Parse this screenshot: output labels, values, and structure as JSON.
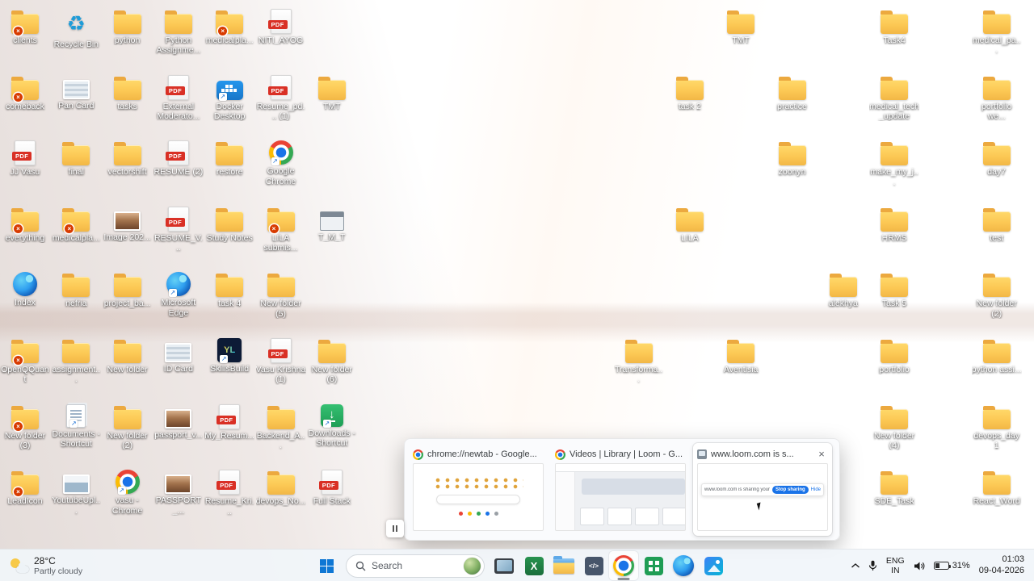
{
  "wallpaper": {
    "sky": "#c6cad1",
    "dune": "#d5b3a0",
    "sun": "#ffffff"
  },
  "desktop": {
    "glyphs": {
      "pdf": "PDF",
      "skills": "YL",
      "download": "↓",
      "recycle": "♻"
    },
    "shortcut_glyph": "↗",
    "badge_glyph": "×",
    "icons": [
      {
        "label": "clients",
        "type": "folder",
        "col": 0,
        "row": 0,
        "badge": true
      },
      {
        "label": "comeback",
        "type": "folder",
        "col": 0,
        "row": 1,
        "badge": true
      },
      {
        "label": "JJ Vasu",
        "type": "pdf",
        "col": 0,
        "row": 2
      },
      {
        "label": "everything",
        "type": "folder",
        "col": 0,
        "row": 3,
        "badge": true
      },
      {
        "label": "Index",
        "type": "edge",
        "col": 0,
        "row": 4
      },
      {
        "label": "OpenQQuant",
        "type": "folder",
        "col": 0,
        "row": 5,
        "badge": true
      },
      {
        "label": "New folder (3)",
        "type": "folder",
        "col": 0,
        "row": 6,
        "badge": true
      },
      {
        "label": "LeadIcon",
        "type": "folder",
        "col": 0,
        "row": 7,
        "badge": true
      },
      {
        "label": "Recycle Bin",
        "type": "recycle",
        "col": 1,
        "row": 0
      },
      {
        "label": "Pan Card",
        "type": "photo",
        "variant": "card",
        "col": 1,
        "row": 1
      },
      {
        "label": "final",
        "type": "folder",
        "col": 1,
        "row": 2
      },
      {
        "label": "medicalpla...",
        "type": "folder",
        "col": 1,
        "row": 3,
        "badge": true
      },
      {
        "label": "nefria",
        "type": "folder",
        "col": 1,
        "row": 4
      },
      {
        "label": "assignment...",
        "type": "folder",
        "col": 1,
        "row": 5
      },
      {
        "label": "Documents - Shortcut",
        "type": "docs",
        "col": 1,
        "row": 6,
        "shortcut": true
      },
      {
        "label": "YoutubeUpl...",
        "type": "photo",
        "variant": "video",
        "col": 1,
        "row": 7
      },
      {
        "label": "python",
        "type": "folder",
        "col": 2,
        "row": 0
      },
      {
        "label": "tasks",
        "type": "folder",
        "col": 2,
        "row": 1
      },
      {
        "label": "vectorshift",
        "type": "folder",
        "col": 2,
        "row": 2
      },
      {
        "label": "Image 202...",
        "type": "photo",
        "variant": "person",
        "col": 2,
        "row": 3
      },
      {
        "label": "project_ba...",
        "type": "folder",
        "col": 2,
        "row": 4
      },
      {
        "label": "New folder",
        "type": "folder",
        "col": 2,
        "row": 5
      },
      {
        "label": "New folder (2)",
        "type": "folder",
        "col": 2,
        "row": 6
      },
      {
        "label": "vasu - Chrome",
        "type": "chrome",
        "col": 2,
        "row": 7,
        "shortcut": true
      },
      {
        "label": "Python Assignme...",
        "type": "folder",
        "col": 3,
        "row": 0
      },
      {
        "label": "External Moderato...",
        "type": "pdf",
        "col": 3,
        "row": 1
      },
      {
        "label": "RESUME (2)",
        "type": "pdf",
        "col": 3,
        "row": 2
      },
      {
        "label": "RESUME_V...",
        "type": "pdf",
        "col": 3,
        "row": 3
      },
      {
        "label": "Microsoft Edge",
        "type": "edge",
        "col": 3,
        "row": 4,
        "shortcut": true
      },
      {
        "label": "ID Card",
        "type": "photo",
        "variant": "card",
        "col": 3,
        "row": 5
      },
      {
        "label": "passport_v...",
        "type": "photo",
        "variant": "person",
        "col": 3,
        "row": 6
      },
      {
        "label": "PASSPORT_...",
        "type": "photo",
        "variant": "person",
        "col": 3,
        "row": 7
      },
      {
        "label": "medicalpla...",
        "type": "folder",
        "col": 4,
        "row": 0,
        "badge": true
      },
      {
        "label": "Docker Desktop",
        "type": "docker",
        "col": 4,
        "row": 1,
        "shortcut": true
      },
      {
        "label": "restore",
        "type": "folder",
        "col": 4,
        "row": 2
      },
      {
        "label": "Study Notes",
        "type": "folder",
        "col": 4,
        "row": 3
      },
      {
        "label": "task 4",
        "type": "folder",
        "col": 4,
        "row": 4
      },
      {
        "label": "SkillsBuild",
        "type": "skills",
        "col": 4,
        "row": 5,
        "shortcut": true
      },
      {
        "label": "My_Resum...",
        "type": "pdf",
        "col": 4,
        "row": 6
      },
      {
        "label": "Resume_Kri...",
        "type": "pdf",
        "col": 4,
        "row": 7
      },
      {
        "label": "NITI_AYOG",
        "type": "pdf",
        "col": 5,
        "row": 0
      },
      {
        "label": "Resume_pd... (1)",
        "type": "pdf",
        "col": 5,
        "row": 1
      },
      {
        "label": "Google Chrome",
        "type": "chrome",
        "col": 5,
        "row": 2,
        "shortcut": true
      },
      {
        "label": "LILA submis...",
        "type": "folder",
        "col": 5,
        "row": 3,
        "badge": true
      },
      {
        "label": "New folder (5)",
        "type": "folder",
        "col": 5,
        "row": 4
      },
      {
        "label": "Vasu Krishna (1)",
        "type": "pdf",
        "col": 5,
        "row": 5
      },
      {
        "label": "Backend_A...",
        "type": "folder",
        "col": 5,
        "row": 6
      },
      {
        "label": "devops_No...",
        "type": "folder",
        "col": 5,
        "row": 7
      },
      {
        "label": "TMT",
        "type": "folder",
        "col": 6,
        "row": 1
      },
      {
        "label": "T_M_T",
        "type": "app",
        "col": 6,
        "row": 3
      },
      {
        "label": "New folder (6)",
        "type": "folder",
        "col": 6,
        "row": 5
      },
      {
        "label": "Downloads - Shortcut",
        "type": "download",
        "col": 6,
        "row": 6,
        "shortcut": true
      },
      {
        "label": "Full Stack",
        "type": "pdf",
        "col": 6,
        "row": 7
      },
      {
        "label": "Transforma...",
        "type": "folder",
        "col": 12,
        "row": 5
      },
      {
        "label": "task 2",
        "type": "folder",
        "col": 13,
        "row": 1
      },
      {
        "label": "LILA",
        "type": "folder",
        "col": 13,
        "row": 3
      },
      {
        "label": "TMT",
        "type": "folder",
        "col": 14,
        "row": 0
      },
      {
        "label": "Aventisia",
        "type": "folder",
        "col": 14,
        "row": 5
      },
      {
        "label": "practice",
        "type": "folder",
        "col": 15,
        "row": 1
      },
      {
        "label": "zoonyn",
        "type": "folder",
        "col": 15,
        "row": 2
      },
      {
        "label": "alekhya",
        "type": "folder",
        "col": 16,
        "row": 4
      },
      {
        "label": "Task4",
        "type": "folder",
        "col": 17,
        "row": 0
      },
      {
        "label": "medical_tech_update",
        "type": "folder",
        "col": 17,
        "row": 1
      },
      {
        "label": "make_my_j...",
        "type": "folder",
        "col": 17,
        "row": 2
      },
      {
        "label": "HRMS",
        "type": "folder",
        "col": 17,
        "row": 3
      },
      {
        "label": "Task 5",
        "type": "folder",
        "col": 17,
        "row": 4
      },
      {
        "label": "portfolio",
        "type": "folder",
        "col": 17,
        "row": 5
      },
      {
        "label": "New folder (4)",
        "type": "folder",
        "col": 17,
        "row": 6
      },
      {
        "label": "SDE_Task",
        "type": "folder",
        "col": 17,
        "row": 7
      },
      {
        "label": "medical_pa...",
        "type": "folder",
        "col": 19,
        "row": 0
      },
      {
        "label": "portfolio we...",
        "type": "folder",
        "col": 19,
        "row": 1
      },
      {
        "label": "day7",
        "type": "folder",
        "col": 19,
        "row": 2
      },
      {
        "label": "test",
        "type": "folder",
        "col": 19,
        "row": 3
      },
      {
        "label": "New folder (2)",
        "type": "folder",
        "col": 19,
        "row": 4
      },
      {
        "label": "python assi...",
        "type": "folder",
        "col": 19,
        "row": 5
      },
      {
        "label": "devops_day1",
        "type": "folder",
        "col": 19,
        "row": 6
      },
      {
        "label": "React_Word",
        "type": "folder",
        "col": 19,
        "row": 7
      }
    ]
  },
  "popup": {
    "close_glyph": "×",
    "cards": [
      {
        "title": "chrome://newtab - Google..."
      },
      {
        "title": "Videos | Library | Loom - G..."
      },
      {
        "title": "www.loom.com is s...",
        "sharing_text": "www.loom.com is sharing your screen",
        "stop_button": "Stop sharing",
        "hide_link": "Hide"
      }
    ]
  },
  "taskbar": {
    "weather": {
      "temp": "28°C",
      "condition": "Partly cloudy"
    },
    "search_placeholder": "Search",
    "apps": [
      "monitor-app",
      "excel",
      "file-explorer",
      "dev-app",
      "chrome",
      "grid-app",
      "edge",
      "photos"
    ],
    "glyphs": {
      "excel": "X",
      "dev": "</>"
    },
    "tray": {
      "lang_line1": "ENG",
      "lang_line2": "IN",
      "battery_percent": "31%",
      "time": "01:03",
      "date": "09-04-2026"
    }
  }
}
